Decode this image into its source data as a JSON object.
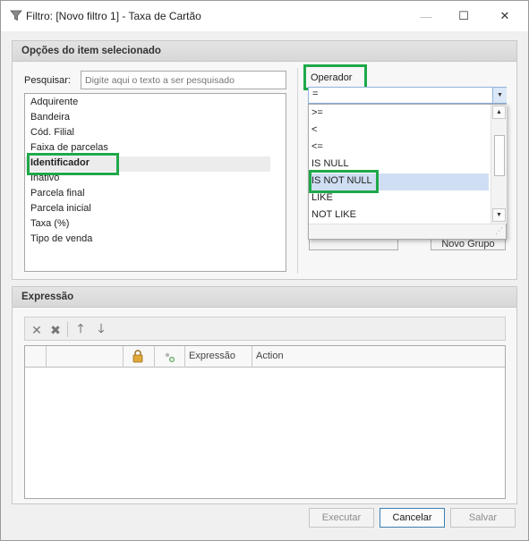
{
  "window": {
    "title": "Filtro: [Novo filtro 1] - Taxa de Cartão",
    "minimize": "—",
    "maximize": "☐",
    "close": "✕"
  },
  "options": {
    "header": "Opções do item selecionado",
    "search_label": "Pesquisar:",
    "search_placeholder": "Digite aqui o texto a ser pesquisado",
    "fields": [
      "Adquirente",
      "Bandeira",
      "Cód. Filial",
      "Faixa de parcelas",
      "Identificador",
      "Inativo",
      "Parcela final",
      "Parcela inicial",
      "Taxa (%)",
      "Tipo de venda"
    ],
    "selected_field": "Identificador"
  },
  "operator": {
    "label": "Operador",
    "value": "=",
    "options": [
      ">=",
      "<",
      "<=",
      "IS NULL",
      "IS NOT NULL",
      "LIKE",
      "NOT LIKE"
    ],
    "selected_option": "IS NOT NULL",
    "hidden_button": "Novo Grupo"
  },
  "expression": {
    "header": "Expressão",
    "columns": [
      "Expressão",
      "Action"
    ]
  },
  "footer": {
    "execute": "Executar",
    "cancel": "Cancelar",
    "save": "Salvar"
  },
  "colors": {
    "highlight": "#1fa84a",
    "selection": "#cfdef3",
    "focus_border": "#3c7fb1"
  }
}
